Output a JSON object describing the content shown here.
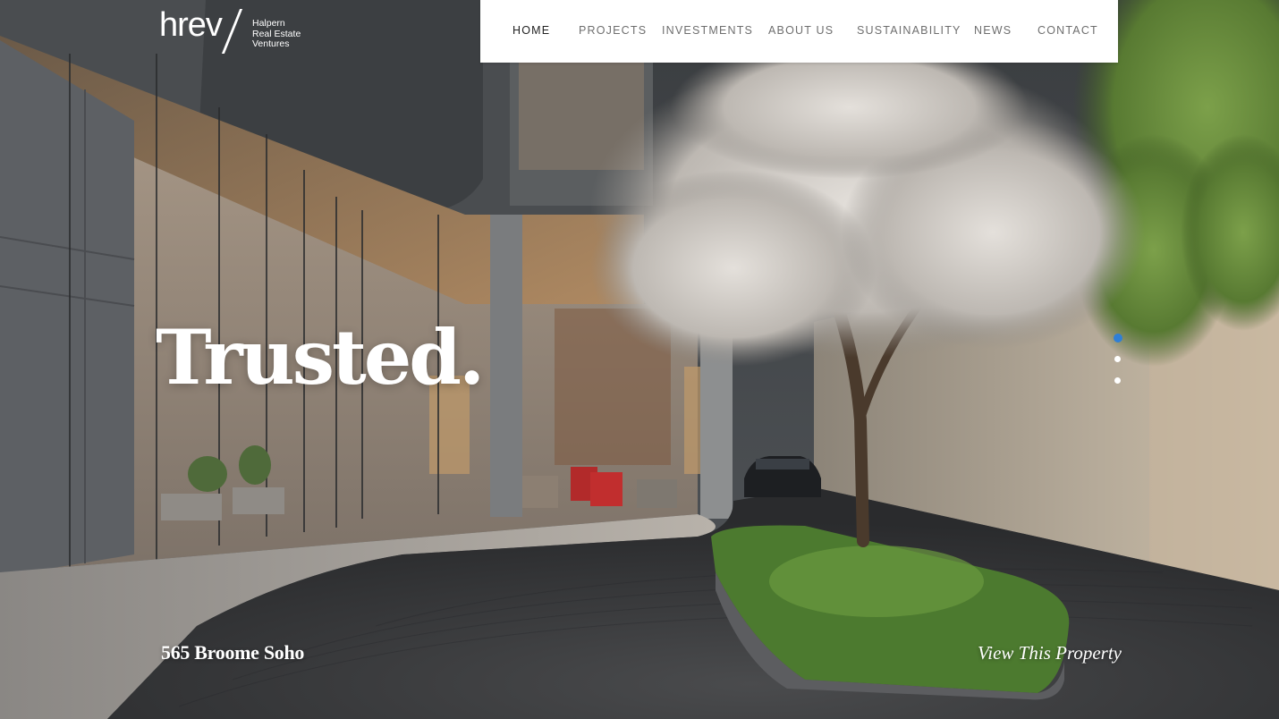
{
  "brand": {
    "mark": "hrev",
    "name_lines": [
      "Halpern",
      "Real Estate",
      "Ventures"
    ]
  },
  "nav": {
    "items": [
      {
        "label": "HOME",
        "active": true
      },
      {
        "label": "PROJECTS",
        "active": false
      },
      {
        "label": "INVESTMENTS",
        "active": false
      },
      {
        "label": "ABOUT US",
        "active": false
      },
      {
        "label": "SUSTAINABILITY",
        "active": false
      },
      {
        "label": "NEWS",
        "active": false
      },
      {
        "label": "CONTACT",
        "active": false
      }
    ]
  },
  "hero": {
    "headline": "Trusted.",
    "property_name": "565 Broome Soho",
    "cta": "View This Property"
  },
  "slider": {
    "count": 3,
    "active_index": 0,
    "active_color": "#2f7fd6"
  },
  "colors": {
    "nav_bg": "#ffffff",
    "nav_text": "#6e6e6e",
    "nav_active": "#222222",
    "hero_text": "#ffffff"
  }
}
